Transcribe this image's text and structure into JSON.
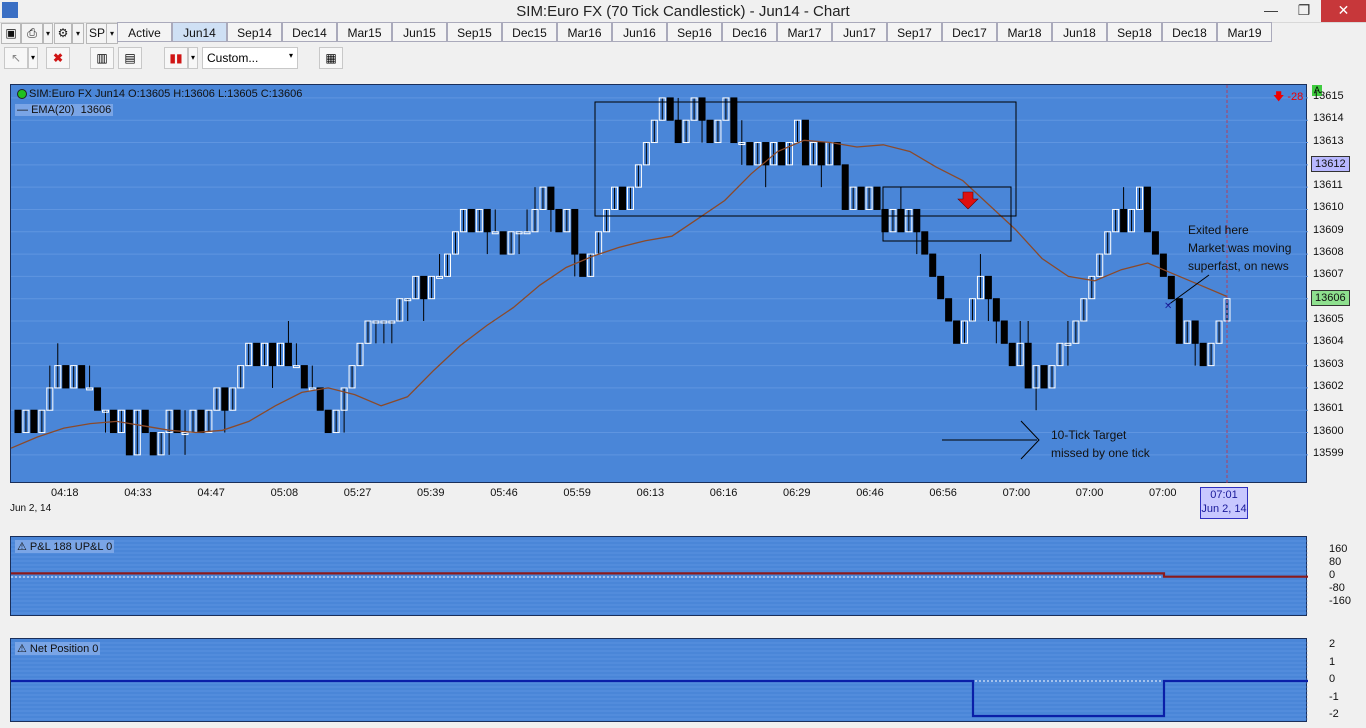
{
  "window": {
    "title": "SIM:Euro FX (70 Tick Candlestick) - Jun14 - Chart",
    "min": "—",
    "max": "❐",
    "close": "✕"
  },
  "toolbar": {
    "instrument": "SP",
    "tabs": [
      "Active",
      "Jun14",
      "Sep14",
      "Dec14",
      "Mar15",
      "Jun15",
      "Sep15",
      "Dec15",
      "Mar16",
      "Jun16",
      "Sep16",
      "Dec16",
      "Mar17",
      "Jun17",
      "Sep17",
      "Dec17",
      "Mar18",
      "Jun18",
      "Sep18",
      "Dec18",
      "Mar19"
    ],
    "selected_tab": "Jun14",
    "template_select": "Custom..."
  },
  "main_panel": {
    "info_line": "SIM:Euro FX Jun14 O:13605 H:13606 L:13605 C:13606",
    "ema_label": "EMA(20)",
    "ema_value": "13606",
    "position_marker": "-28",
    "a_badge": "A",
    "price_ticks": [
      "13615",
      "13614",
      "13613",
      "13612",
      "13611",
      "13610",
      "13609",
      "13608",
      "13607",
      "13606",
      "13605",
      "13604",
      "13603",
      "13602",
      "13601",
      "13600",
      "13599"
    ],
    "price_flags": [
      {
        "value": "13612",
        "color": "#b8b8ff"
      },
      {
        "value": "13606",
        "color": "#8ee08e"
      }
    ],
    "time_ticks": [
      "04:18",
      "04:33",
      "04:47",
      "05:08",
      "05:27",
      "05:39",
      "05:46",
      "05:59",
      "06:13",
      "06:16",
      "06:29",
      "06:46",
      "06:56",
      "07:00",
      "07:00",
      "07:00",
      "07:..."
    ],
    "date_label": "Jun 2, 14",
    "cursor_time": "07:01",
    "cursor_date": "Jun 2, 14",
    "annotation_exit": [
      "Exited here",
      "Market was moving",
      "superfast, on news"
    ],
    "annotation_target": [
      "10-Tick Target",
      "missed by one tick"
    ]
  },
  "pnl_panel": {
    "label": "P&L  188  UP&L  0",
    "ticks": [
      "160",
      "80",
      "0",
      "-80",
      "-160"
    ],
    "color": "#8b1a1a"
  },
  "netpos_panel": {
    "label": "Net Position  0",
    "ticks": [
      "2",
      "1",
      "0",
      "-1",
      "-2"
    ],
    "color": "#0a1fa8"
  },
  "chart_data": {
    "type": "candlestick",
    "title": "SIM:Euro FX (70 Tick Candlestick) - Jun14",
    "ylim": [
      13598.5,
      13615.4
    ],
    "series_candles": [
      [
        13601,
        13600,
        13601,
        13600
      ],
      [
        13600,
        13601,
        13601,
        13600
      ],
      [
        13601,
        13600,
        13601,
        13600
      ],
      [
        13600,
        13601,
        13601,
        13600
      ],
      [
        13601,
        13602,
        13603,
        13601
      ],
      [
        13602,
        13603,
        13604,
        13602
      ],
      [
        13603,
        13602,
        13603,
        13602
      ],
      [
        13602,
        13603,
        13603,
        13602
      ],
      [
        13603,
        13602,
        13603,
        13602
      ],
      [
        13602,
        13602,
        13603,
        13602
      ],
      [
        13602,
        13601,
        13602,
        13601
      ],
      [
        13601,
        13601,
        13601,
        13600
      ],
      [
        13601,
        13600,
        13601,
        13600
      ],
      [
        13600,
        13601,
        13601,
        13600
      ],
      [
        13601,
        13599,
        13601,
        13599
      ],
      [
        13599,
        13601,
        13601,
        13599
      ],
      [
        13601,
        13600,
        13601,
        13600
      ],
      [
        13600,
        13599,
        13600,
        13599
      ],
      [
        13599,
        13600,
        13600,
        13599
      ],
      [
        13600,
        13601,
        13601,
        13599
      ],
      [
        13601,
        13600,
        13601,
        13600
      ],
      [
        13600,
        13600,
        13601,
        13599
      ],
      [
        13600,
        13601,
        13601,
        13600
      ],
      [
        13601,
        13600,
        13601,
        13600
      ],
      [
        13600,
        13601,
        13601,
        13600
      ],
      [
        13601,
        13602,
        13602,
        13601
      ],
      [
        13602,
        13601,
        13602,
        13600
      ],
      [
        13601,
        13602,
        13602,
        13601
      ],
      [
        13602,
        13603,
        13603,
        13602
      ],
      [
        13603,
        13604,
        13604,
        13603
      ],
      [
        13604,
        13603,
        13604,
        13603
      ],
      [
        13603,
        13604,
        13604,
        13603
      ],
      [
        13604,
        13603,
        13604,
        13602
      ],
      [
        13603,
        13604,
        13604,
        13603
      ],
      [
        13604,
        13603,
        13605,
        13603
      ],
      [
        13603,
        13603,
        13604,
        13603
      ],
      [
        13603,
        13602,
        13603,
        13602
      ],
      [
        13602,
        13602,
        13603,
        13602
      ],
      [
        13602,
        13601,
        13602,
        13601
      ],
      [
        13601,
        13600,
        13601,
        13600
      ],
      [
        13600,
        13601,
        13601,
        13600
      ],
      [
        13601,
        13602,
        13602,
        13600
      ],
      [
        13602,
        13603,
        13603,
        13602
      ],
      [
        13603,
        13604,
        13604,
        13603
      ],
      [
        13604,
        13605,
        13605,
        13604
      ],
      [
        13605,
        13605,
        13605,
        13604
      ],
      [
        13605,
        13605,
        13605,
        13604
      ],
      [
        13605,
        13605,
        13605,
        13604
      ],
      [
        13605,
        13606,
        13606,
        13605
      ],
      [
        13606,
        13606,
        13606,
        13605
      ],
      [
        13606,
        13607,
        13607,
        13606
      ],
      [
        13607,
        13606,
        13607,
        13605
      ],
      [
        13606,
        13607,
        13607,
        13606
      ],
      [
        13607,
        13607,
        13608,
        13607
      ],
      [
        13607,
        13608,
        13608,
        13607
      ],
      [
        13608,
        13609,
        13609,
        13608
      ],
      [
        13609,
        13610,
        13610,
        13609
      ],
      [
        13610,
        13609,
        13610,
        13609
      ],
      [
        13609,
        13610,
        13610,
        13609
      ],
      [
        13610,
        13609,
        13610,
        13608
      ],
      [
        13609,
        13609,
        13610,
        13609
      ],
      [
        13609,
        13608,
        13609,
        13608
      ],
      [
        13608,
        13609,
        13609,
        13608
      ],
      [
        13609,
        13609,
        13609,
        13608
      ],
      [
        13609,
        13609,
        13610,
        13609
      ],
      [
        13609,
        13610,
        13611,
        13609
      ],
      [
        13610,
        13611,
        13611,
        13610
      ],
      [
        13611,
        13610,
        13611,
        13609
      ],
      [
        13610,
        13609,
        13610,
        13609
      ],
      [
        13609,
        13610,
        13610,
        13609
      ],
      [
        13610,
        13608,
        13610,
        13607
      ],
      [
        13608,
        13607,
        13608,
        13607
      ],
      [
        13607,
        13608,
        13608,
        13607
      ],
      [
        13608,
        13609,
        13609,
        13608
      ],
      [
        13609,
        13610,
        13610,
        13609
      ],
      [
        13610,
        13611,
        13611,
        13610
      ],
      [
        13611,
        13610,
        13611,
        13610
      ],
      [
        13610,
        13611,
        13611,
        13610
      ],
      [
        13611,
        13612,
        13612,
        13611
      ],
      [
        13612,
        13613,
        13613,
        13612
      ],
      [
        13613,
        13614,
        13614,
        13613
      ],
      [
        13614,
        13615,
        13615,
        13614
      ],
      [
        13615,
        13614,
        13615,
        13614
      ],
      [
        13614,
        13613,
        13615,
        13613
      ],
      [
        13613,
        13614,
        13614,
        13613
      ],
      [
        13614,
        13615,
        13615,
        13614
      ],
      [
        13615,
        13614,
        13615,
        13613
      ],
      [
        13614,
        13613,
        13614,
        13613
      ],
      [
        13613,
        13614,
        13614,
        13613
      ],
      [
        13614,
        13615,
        13615,
        13614
      ],
      [
        13615,
        13613,
        13615,
        13613
      ],
      [
        13613,
        13613,
        13614,
        13612
      ],
      [
        13613,
        13612,
        13613,
        13612
      ],
      [
        13612,
        13613,
        13613,
        13612
      ],
      [
        13613,
        13612,
        13613,
        13611
      ],
      [
        13612,
        13613,
        13613,
        13612
      ],
      [
        13613,
        13612,
        13613,
        13612
      ],
      [
        13612,
        13613,
        13613,
        13612
      ],
      [
        13613,
        13614,
        13614,
        13613
      ],
      [
        13614,
        13612,
        13614,
        13612
      ],
      [
        13612,
        13613,
        13613,
        13612
      ],
      [
        13613,
        13612,
        13613,
        13611
      ],
      [
        13612,
        13613,
        13613,
        13612
      ],
      [
        13613,
        13612,
        13613,
        13612
      ],
      [
        13612,
        13610,
        13612,
        13610
      ],
      [
        13610,
        13611,
        13611,
        13610
      ],
      [
        13611,
        13610,
        13611,
        13610
      ],
      [
        13610,
        13611,
        13611,
        13610
      ],
      [
        13611,
        13610,
        13611,
        13610
      ],
      [
        13610,
        13609,
        13610,
        13609
      ],
      [
        13609,
        13610,
        13610,
        13609
      ],
      [
        13610,
        13609,
        13611,
        13609
      ],
      [
        13609,
        13610,
        13610,
        13609
      ],
      [
        13610,
        13609,
        13610,
        13608
      ],
      [
        13609,
        13608,
        13609,
        13608
      ],
      [
        13608,
        13607,
        13608,
        13607
      ],
      [
        13607,
        13606,
        13607,
        13606
      ],
      [
        13606,
        13605,
        13606,
        13605
      ],
      [
        13605,
        13604,
        13605,
        13604
      ],
      [
        13604,
        13605,
        13605,
        13604
      ],
      [
        13605,
        13606,
        13606,
        13605
      ],
      [
        13606,
        13607,
        13608,
        13606
      ],
      [
        13607,
        13606,
        13607,
        13605
      ],
      [
        13606,
        13605,
        13606,
        13604
      ],
      [
        13605,
        13604,
        13605,
        13604
      ],
      [
        13604,
        13603,
        13604,
        13603
      ],
      [
        13603,
        13604,
        13605,
        13603
      ],
      [
        13604,
        13602,
        13605,
        13602
      ],
      [
        13602,
        13603,
        13603,
        13601
      ],
      [
        13603,
        13602,
        13603,
        13602
      ],
      [
        13602,
        13603,
        13603,
        13602
      ],
      [
        13603,
        13604,
        13604,
        13603
      ],
      [
        13604,
        13604,
        13605,
        13603
      ],
      [
        13604,
        13605,
        13605,
        13604
      ],
      [
        13605,
        13606,
        13606,
        13605
      ],
      [
        13606,
        13607,
        13607,
        13606
      ],
      [
        13607,
        13608,
        13608,
        13607
      ],
      [
        13608,
        13609,
        13609,
        13608
      ],
      [
        13609,
        13610,
        13610,
        13609
      ],
      [
        13610,
        13609,
        13611,
        13609
      ],
      [
        13609,
        13610,
        13610,
        13609
      ],
      [
        13610,
        13611,
        13611,
        13610
      ],
      [
        13611,
        13609,
        13611,
        13609
      ],
      [
        13609,
        13608,
        13609,
        13608
      ],
      [
        13608,
        13607,
        13608,
        13607
      ],
      [
        13607,
        13606,
        13607,
        13606
      ],
      [
        13606,
        13604,
        13606,
        13604
      ],
      [
        13604,
        13605,
        13605,
        13604
      ],
      [
        13605,
        13604,
        13605,
        13603
      ],
      [
        13604,
        13603,
        13604,
        13603
      ],
      [
        13603,
        13604,
        13604,
        13603
      ],
      [
        13604,
        13605,
        13605,
        13604
      ],
      [
        13605,
        13606,
        13606,
        13605
      ]
    ],
    "candle_format": [
      "open",
      "close",
      "high",
      "low"
    ],
    "ema20": [
      13599.3,
      13599.8,
      13600.2,
      13600.4,
      13600.5,
      13600.3,
      13600.1,
      13600.0,
      13600.1,
      13600.5,
      13601.2,
      13601.8,
      13602.0,
      13601.7,
      13601.2,
      13601.6,
      13602.8,
      13603.9,
      13604.8,
      13605.6,
      13606.6,
      13607.4,
      13607.9,
      13608.3,
      13608.6,
      13608.8,
      13609.6,
      13610.4,
      13611.6,
      13612.6,
      13613.1,
      13613.0,
      13612.8,
      13612.9,
      13612.6,
      13611.9,
      13611.3,
      13610.2,
      13609.1,
      13607.8,
      13607.0,
      13606.8,
      13607.3,
      13607.6,
      13607.1,
      13606.6,
      13606.1
    ]
  }
}
